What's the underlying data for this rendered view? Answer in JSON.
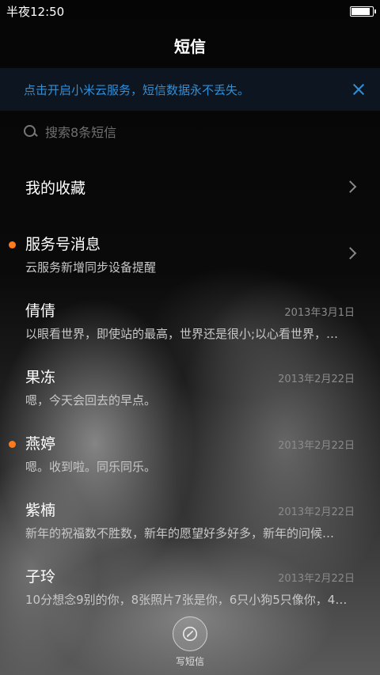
{
  "status_bar": {
    "time": "半夜12:50",
    "battery_level": 0.9
  },
  "header": {
    "title": "短信"
  },
  "banner": {
    "text": "点击开启小米云服务，短信数据永不丢失。",
    "close_icon": "close-icon"
  },
  "search": {
    "placeholder": "搜索8条短信"
  },
  "conversations": [
    {
      "title": "我的收藏",
      "subtitle": "",
      "date": "",
      "unread": false,
      "chevron": true
    },
    {
      "title": "服务号消息",
      "subtitle": "云服务新增同步设备提醒",
      "date": "",
      "unread": true,
      "chevron": true
    },
    {
      "title": "倩倩",
      "subtitle": "以眼看世界，即使站的最高，世界还是很小;以心看世界，…",
      "date": "2013年3月1日",
      "unread": false,
      "chevron": false
    },
    {
      "title": "果冻",
      "subtitle": "嗯，今天会回去的早点。",
      "date": "2013年2月22日",
      "unread": false,
      "chevron": false
    },
    {
      "title": "燕婷",
      "subtitle": "嗯。收到啦。同乐同乐。",
      "date": "2013年2月22日",
      "unread": true,
      "chevron": false
    },
    {
      "title": "紫楠",
      "subtitle": "新年的祝福数不胜数，新年的愿望好多好多，新年的问候…",
      "date": "2013年2月22日",
      "unread": false,
      "chevron": false
    },
    {
      "title": "子玲",
      "subtitle": "10分想念9别的你，8张照片7张是你，6只小狗5只像你，4…",
      "date": "2013年2月22日",
      "unread": false,
      "chevron": false
    }
  ],
  "compose": {
    "label": "写短信",
    "icon": "pen-icon"
  },
  "colors": {
    "accent": "#2f8fd8",
    "unread_dot": "#ff7a1a"
  }
}
